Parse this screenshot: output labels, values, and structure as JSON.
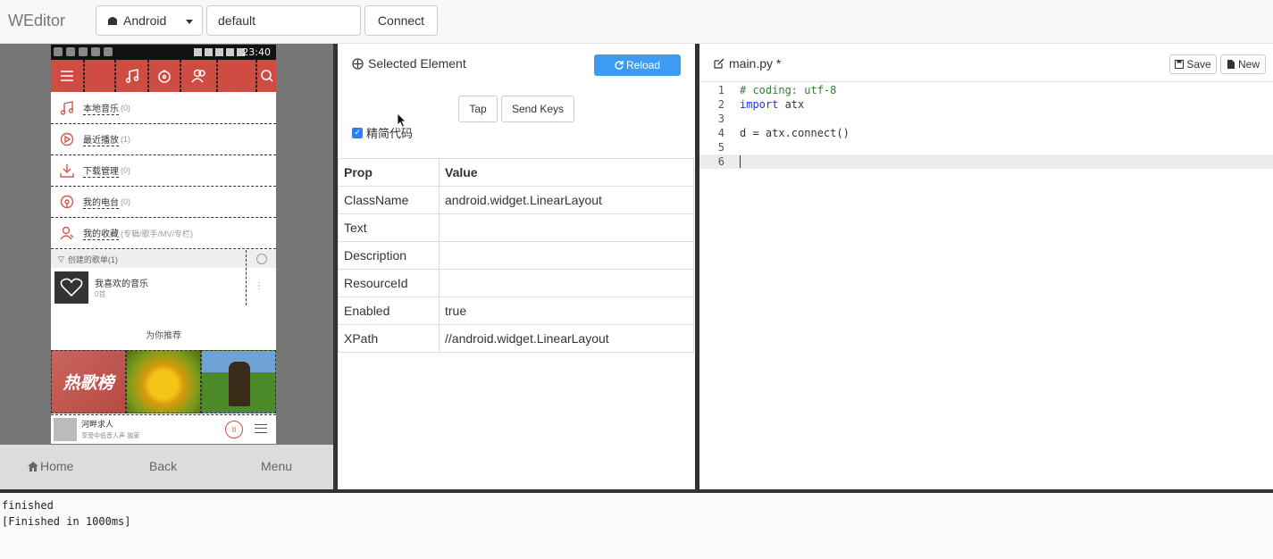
{
  "app": {
    "brand": "WEditor",
    "platform": "Android",
    "serial_value": "default",
    "connect_label": "Connect"
  },
  "device": {
    "status_time": "23:40",
    "menu": [
      {
        "label": "本地音乐",
        "count": "(0)"
      },
      {
        "label": "最近播放",
        "count": "(1)"
      },
      {
        "label": "下载管理",
        "count": "(0)"
      },
      {
        "label": "我的电台",
        "count": "(0)"
      },
      {
        "label": "我的收藏",
        "count": "(专辑/歌手/MV/专栏)"
      }
    ],
    "playlist_header": "创建的歌单(1)",
    "playlist_item": {
      "title": "我喜欢的音乐",
      "sub": "0首"
    },
    "recommend": "为你推荐",
    "tile1_text": "热歌榜",
    "player": {
      "title": "河畔求人",
      "sub": "享受中低音人声·独家"
    },
    "nav": {
      "home": "Home",
      "back": "Back",
      "menu": "Menu"
    }
  },
  "inspector": {
    "title": "Selected Element",
    "reload_label": "Reload",
    "tap_label": "Tap",
    "sendkeys_label": "Send Keys",
    "simplify_label": "精简代码",
    "headers": {
      "prop": "Prop",
      "value": "Value"
    },
    "rows": [
      {
        "prop": "ClassName",
        "value": "android.widget.LinearLayout"
      },
      {
        "prop": "Text",
        "value": ""
      },
      {
        "prop": "Description",
        "value": ""
      },
      {
        "prop": "ResourceId",
        "value": ""
      },
      {
        "prop": "Enabled",
        "value": "true"
      },
      {
        "prop": "XPath",
        "value": "//android.widget.LinearLayout"
      }
    ]
  },
  "editor": {
    "filename": "main.py *",
    "save_label": "Save",
    "new_label": "New",
    "lines": [
      {
        "n": "1",
        "comment": "# coding: utf-8"
      },
      {
        "n": "2",
        "keyword": "import",
        "rest": " atx"
      },
      {
        "n": "3"
      },
      {
        "n": "4",
        "rest": "d = atx.connect()"
      },
      {
        "n": "5"
      },
      {
        "n": "6"
      }
    ]
  },
  "console": {
    "line1": "finished",
    "line2": "[Finished in 1000ms]"
  },
  "colors": {
    "reload": "#3c9cf2",
    "app_red": "#cf4c43",
    "divider": "#333333"
  }
}
